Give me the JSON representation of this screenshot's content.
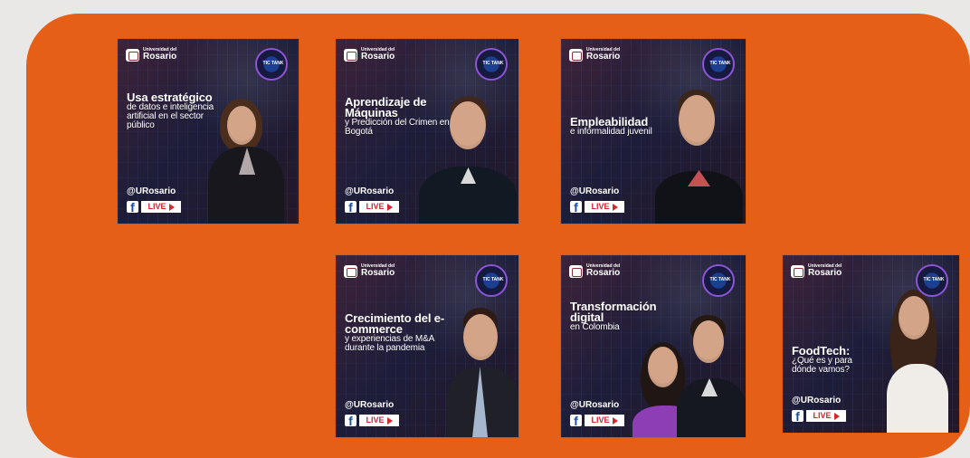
{
  "cards": [
    {
      "brand_small": "Universidad del",
      "brand_big": "Rosario",
      "tank": "TIC\nTANK",
      "title_strong": "Usa estratégico",
      "title_light": "de datos e inteligencia artificial en el sector público",
      "handle": "@URosario",
      "facebook_icon": "facebook-icon",
      "live": "LIVE"
    },
    {
      "brand_small": "Universidad del",
      "brand_big": "Rosario",
      "tank": "TIC\nTANK",
      "title_strong": "Aprendizaje de Máquinas",
      "title_light": "y Predicción del Crimen en Bogotá",
      "handle": "@URosario",
      "facebook_icon": "facebook-icon",
      "live": "LIVE"
    },
    {
      "brand_small": "Universidad del",
      "brand_big": "Rosario",
      "tank": "TIC\nTANK",
      "title_strong": "Empleabilidad",
      "title_light": "e informalidad juvenil",
      "handle": "@URosario",
      "facebook_icon": "facebook-icon",
      "live": "LIVE"
    },
    {
      "brand_small": "Universidad del",
      "brand_big": "Rosario",
      "tank": "TIC\nTANK",
      "title_strong": "Crecimiento del e-commerce",
      "title_light": "y experiencias de M&A durante la pandemia",
      "handle": "@URosario",
      "facebook_icon": "facebook-icon",
      "live": "LIVE"
    },
    {
      "brand_small": "Universidad del",
      "brand_big": "Rosario",
      "tank": "TIC\nTANK",
      "title_strong": "Transformación digital",
      "title_light": "en Colombia",
      "handle": "@URosario",
      "facebook_icon": "facebook-icon",
      "live": "LIVE"
    },
    {
      "brand_small": "Universidad del",
      "brand_big": "Rosario",
      "tank": "TIC\nTANK",
      "title_strong": "FoodTech:",
      "title_light": "¿Qué es y para dónde vamos?",
      "handle": "@URosario",
      "facebook_icon": "facebook-icon",
      "live": "LIVE"
    }
  ],
  "colors": {
    "page_background": "#e9e8e7",
    "panel_orange": "#e55f16",
    "card_dark": "#2a1c2f",
    "accent_purple": "#8e54d6",
    "facebook_blue": "#184e9f",
    "live_red": "#d7262b"
  }
}
